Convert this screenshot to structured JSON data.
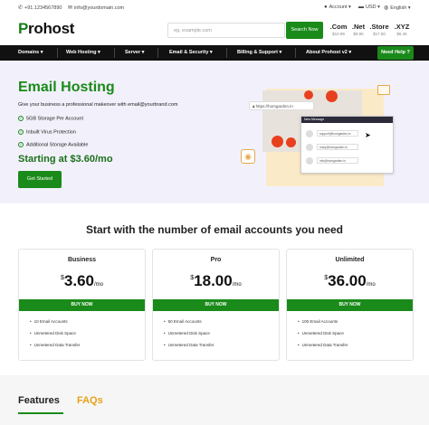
{
  "topbar": {
    "phone": "+91.1234567890",
    "email": "info@yourdomain.com",
    "account": "Account",
    "currency": "USD",
    "language": "English"
  },
  "header": {
    "logo": "Prohost",
    "search_placeholder": "eg. example.com",
    "search_button": "Search Now",
    "tlds": [
      {
        "name": ".Com",
        "price": "$10.99"
      },
      {
        "name": ".Net",
        "price": "$9.95"
      },
      {
        "name": ".Store",
        "price": "$17.50"
      },
      {
        "name": ".XYZ",
        "price": "$6.45"
      }
    ]
  },
  "nav": {
    "items": [
      "Domains ▾",
      "Web Hosting ▾",
      "Server ▾",
      "Email & Security ▾",
      "Billing & Support ▾",
      "About Prohost v2 ▾"
    ],
    "help": "Need Help ?"
  },
  "hero": {
    "title": "Email Hosting",
    "subtitle": "Give your business a professional makeover with email@yourbrand.com",
    "features": [
      "5GB Storage Per Account",
      "Inbuilt Virus Protection",
      "Additional Storage Available"
    ],
    "starting": "Starting at $3.60/mo",
    "cta": "Get Started",
    "url": "https://homgarden.in",
    "window_title": "New Message",
    "emails": [
      "support@homgarden.in",
      "mary@homgarden.in",
      "info@homgarden.in"
    ]
  },
  "pricing": {
    "title": "Start with the number of email accounts you need",
    "plans": [
      {
        "name": "Business",
        "currency": "$",
        "amount": "3.60",
        "per": "/mo",
        "buy": "BUY NOW",
        "features": [
          "10 Email Accounts",
          "Unmetered Disk Space",
          "Unmetered Data Transfer"
        ]
      },
      {
        "name": "Pro",
        "currency": "$",
        "amount": "18.00",
        "per": "/mo",
        "buy": "BUY NOW",
        "features": [
          "50 Email Accounts",
          "Unmetered Disk Space",
          "Unmetered Data Transfer"
        ]
      },
      {
        "name": "Unlimited",
        "currency": "$",
        "amount": "36.00",
        "per": "/mo",
        "buy": "BUY NOW",
        "features": [
          "100 Email Accounts",
          "Unmetered Disk Space",
          "Unmetered Data Transfer"
        ]
      }
    ]
  },
  "tabs": {
    "features": "Features",
    "faqs": "FAQs"
  },
  "colors": {
    "brand_green": "#1a8a1a",
    "accent_orange": "#e8a21a",
    "nav_bg": "#111111"
  }
}
